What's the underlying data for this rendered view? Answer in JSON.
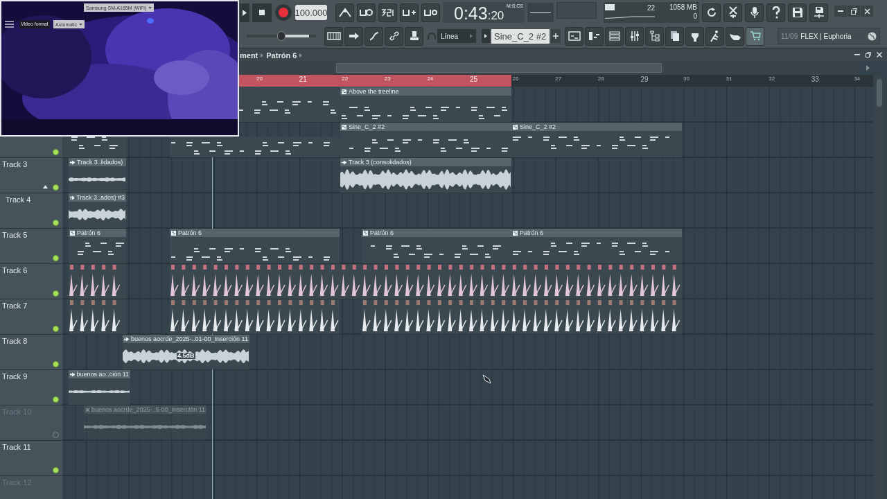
{
  "webcam": {
    "device": "Samsung SM-A165M (WiFi)",
    "format_label": "Video format",
    "format_value": "Automatic"
  },
  "transport": {
    "tempo": "100.000",
    "time_main": "0:43",
    "time_sub": ":20",
    "time_unit": "M:S:CS"
  },
  "master_pitch": {
    "level": 0.5
  },
  "monitor": {
    "voices": "22",
    "memory": "1058 MB",
    "cpu": "0"
  },
  "snap": "Línea",
  "pattern": "Sine_C_2 #2",
  "news": {
    "date": "11/09",
    "text": "FLEX | Euphoria"
  },
  "breadcrumb": [
    "ment",
    "Patrón 6"
  ],
  "ruler": [
    {
      "label": "20",
      "in_loop": true
    },
    {
      "label": "21",
      "in_loop": true
    },
    {
      "label": "22",
      "in_loop": true
    },
    {
      "label": "23",
      "in_loop": true
    },
    {
      "label": "24",
      "in_loop": true
    },
    {
      "label": "25",
      "in_loop": true
    },
    {
      "label": "26",
      "in_loop": false
    },
    {
      "label": "27",
      "in_loop": false
    },
    {
      "label": "28",
      "in_loop": false
    },
    {
      "label": "29",
      "in_loop": false
    },
    {
      "label": "30",
      "in_loop": false
    },
    {
      "label": "31",
      "in_loop": false
    },
    {
      "label": "32",
      "in_loop": false
    },
    {
      "label": "33",
      "in_loop": false
    },
    {
      "label": "34",
      "in_loop": false
    }
  ],
  "tracks": [
    {
      "clips": [
        {
          "kind": "pattern"
        },
        {
          "kind": "pattern",
          "label": "Above the treeline"
        }
      ]
    },
    {
      "muted": false,
      "clips": [
        {
          "kind": "pattern"
        },
        {
          "kind": "pattern"
        },
        {
          "kind": "pattern",
          "label": "Sine_C_2 #2"
        },
        {
          "kind": "pattern",
          "label": "Sine_C_2 #2"
        }
      ]
    },
    {
      "name": "Track 3",
      "muted": false,
      "clips": [
        {
          "kind": "audio",
          "label": "Track 3..lidados)"
        },
        {
          "kind": "audio",
          "label": "Track 3 (consolidados)"
        }
      ]
    },
    {
      "name": "Track 4",
      "muted": false,
      "clips": [
        {
          "kind": "audio",
          "label": "Track 3..ados) #3"
        }
      ]
    },
    {
      "name": "Track 5",
      "muted": false,
      "clips": [
        {
          "kind": "pattern",
          "label": "Patrón 6"
        },
        {
          "kind": "pattern",
          "label": "Patrón 6"
        },
        {
          "kind": "pattern",
          "label": "Patrón 6"
        },
        {
          "kind": "pattern",
          "label": "Patrón 6"
        }
      ]
    },
    {
      "name": "Track 6",
      "muted": false,
      "clips": [
        {
          "kind": "drums"
        },
        {
          "kind": "drums"
        }
      ]
    },
    {
      "name": "Track 7",
      "muted": false,
      "clips": [
        {
          "kind": "drums"
        },
        {
          "kind": "drums"
        },
        {
          "kind": "drums"
        }
      ]
    },
    {
      "name": "Track 8",
      "muted": false,
      "clips": [
        {
          "kind": "audio",
          "label": "buenos aocrde_2025-..01-00_Inserción 11",
          "gain": "4.5dB"
        }
      ]
    },
    {
      "name": "Track 9",
      "muted": false,
      "clips": [
        {
          "kind": "audio",
          "label": "buenos ao..ción 11"
        }
      ]
    },
    {
      "name": "Track 10",
      "muted": true,
      "clips": [
        {
          "kind": "audio",
          "label": "buenos aocrde_2025-..5-00_Inserción 11"
        }
      ]
    },
    {
      "name": "Track 11",
      "muted": false
    },
    {
      "name": "Track 12",
      "muted": true
    }
  ]
}
